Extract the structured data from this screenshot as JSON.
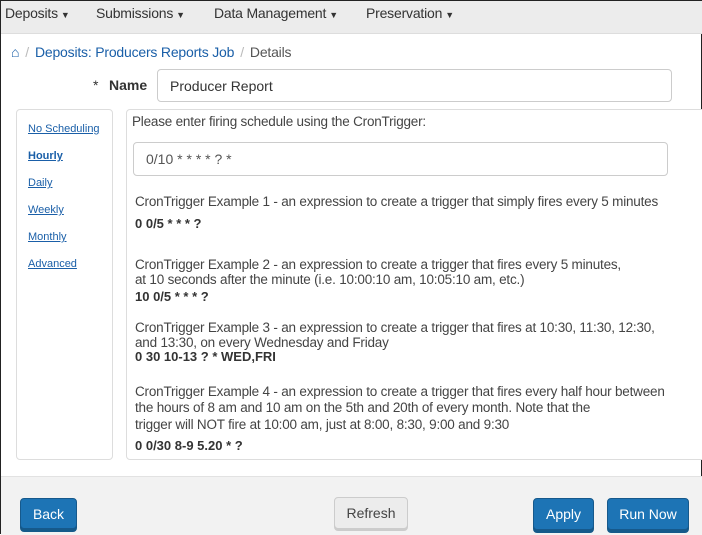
{
  "nav": [
    "Deposits",
    "Submissions",
    "Data Management",
    "Preservation"
  ],
  "breadcrumb": {
    "home_icon": "home-icon",
    "items": [
      "Deposits: Producers Reports Job",
      "Details"
    ]
  },
  "form": {
    "name_required": "*",
    "name_label": "Name",
    "name_value": "Producer Report"
  },
  "sidebar": [
    "No Scheduling",
    "Hourly",
    "Daily",
    "Weekly",
    "Monthly",
    "Advanced"
  ],
  "main": {
    "prompt": "Please enter firing schedule using the CronTrigger:",
    "cron_value": "0/10 * * * * ? *",
    "examples": [
      {
        "lines": [
          "CronTrigger Example 1 - an expression to create a trigger that simply fires every 5 minutes"
        ],
        "code": "0 0/5 * * * ?"
      },
      {
        "lines": [
          "CronTrigger Example 2 - an expression to create a trigger that fires every 5 minutes,",
          " at 10 seconds after the minute (i.e. 10:00:10 am, 10:05:10 am, etc.)"
        ],
        "code": "10 0/5 * * * ?"
      },
      {
        "lines": [
          "CronTrigger Example 3 - an expression to create a trigger that fires at 10:30, 11:30, 12:30,",
          "and 13:30, on every Wednesday and Friday"
        ],
        "code": "0 30 10-13 ? * WED,FRI"
      },
      {
        "lines": [
          "CronTrigger Example 4 - an expression to create a trigger that fires every half hour between",
          "the hours of 8 am and 10 am on the 5th and 20th of every month. Note that the",
          "trigger will NOT fire at 10:00 am, just at 8:00, 8:30, 9:00 and 9:30"
        ],
        "code": "0 0/30 8-9 5.20 * ?"
      }
    ]
  },
  "buttons": {
    "back": "Back",
    "refresh": "Refresh",
    "apply": "Apply",
    "run_now": "Run Now"
  }
}
